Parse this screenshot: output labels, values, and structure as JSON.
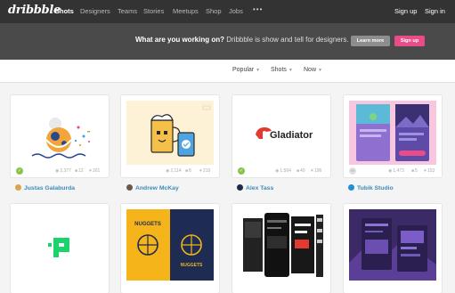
{
  "brand": {
    "logo": "dribbble"
  },
  "nav": {
    "items": [
      "Shots",
      "Designers",
      "Teams",
      "Stories",
      "Meetups",
      "Shop",
      "Jobs"
    ],
    "more": "•••",
    "signup": "Sign up",
    "signin": "Sign in"
  },
  "hero": {
    "question": "What are you working on?",
    "tagline": " Dribbble is show and tell for designers.",
    "learn_more": "Learn more",
    "signup": "Sign up"
  },
  "filters": {
    "sort": "Popular",
    "type": "Shots",
    "time": "Now"
  },
  "shots": [
    {
      "views": "2,377",
      "comments": "12",
      "likes": "261",
      "author": "Justas Galaburda",
      "badge_icon": "check-icon",
      "avatar_color": "#d7a64a"
    },
    {
      "views": "2,114",
      "comments": "8",
      "likes": "219",
      "author": "Andrew McKay",
      "badge_icon": "none",
      "avatar_color": "#6b5a48"
    },
    {
      "views": "1,564",
      "comments": "40",
      "likes": "196",
      "author": "Alex Tass",
      "badge_icon": "check-icon",
      "avatar_color": "#1f2a44"
    },
    {
      "views": "1,473",
      "comments": "5",
      "likes": "153",
      "author": "Tubik Studio",
      "badge_icon": "link-icon",
      "avatar_color": "#1f8fd6"
    }
  ],
  "gladiator_wordmark": "Gladiator",
  "nuggets_text": "NUGGETS"
}
